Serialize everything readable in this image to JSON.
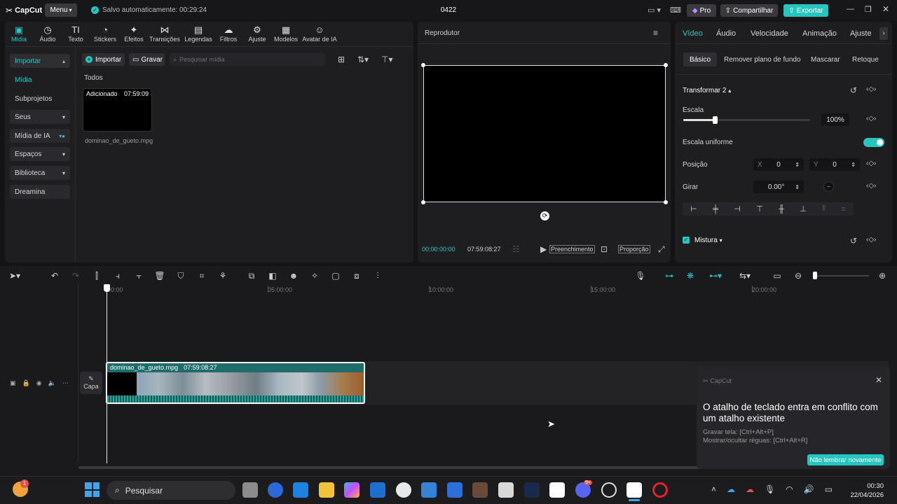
{
  "app": {
    "logo": "CapCut",
    "menu": "Menu",
    "saved": "Salvo automaticamente: 00:29:24",
    "project": "0422",
    "pro": "Pro",
    "share": "Compartilhar",
    "export": "Exportar"
  },
  "media_tabs": [
    "Mídia",
    "Áudio",
    "Texto",
    "Stickers",
    "Efeitos",
    "Transições",
    "Legendas",
    "Filtros",
    "Ajuste",
    "Modelos",
    "Avatar de IA"
  ],
  "sidebar": {
    "items": [
      "Importar",
      "Mídia",
      "Subprojetos",
      "Seus",
      "Mídia de IA",
      "Espaços",
      "Biblioteca",
      "Dreamina"
    ]
  },
  "media": {
    "import": "Importar",
    "record": "Gravar",
    "search_placeholder": "Pesquisar mídia",
    "section": "Todos",
    "clip_badge": "Adicionado",
    "clip_duration": "07:59:09",
    "clip_name": "dominao_de_gueto.mpg"
  },
  "player": {
    "title": "Reprodutor",
    "time_current": "00:00:00:00",
    "time_total": "07:59:08:27",
    "fill": "Preenchimento",
    "ratio": "Proporção"
  },
  "inspector": {
    "tabs": [
      "Vídeo",
      "Áudio",
      "Velocidade",
      "Animação",
      "Ajuste"
    ],
    "subtabs": [
      "Básico",
      "Remover plano de fundo",
      "Mascarar",
      "Retoque"
    ],
    "transform": "Transformar 2",
    "scale_label": "Escala",
    "scale_value": "100%",
    "scale_fraction": 0.25,
    "uniform": "Escala uniforme",
    "position": "Posição",
    "pos_x_label": "X",
    "pos_x": "0",
    "pos_y_label": "Y",
    "pos_y": "0",
    "rotate": "Girar",
    "rotate_value": "0.00°",
    "blend": "Mistura"
  },
  "timeline": {
    "ruler": [
      "00:00",
      "05:00:00",
      "10:00:00",
      "15:00:00",
      "20:00:00"
    ],
    "cover": "Capa",
    "clip_name": "dominao_de_gueto.mpg",
    "clip_duration": "07:59:08:27"
  },
  "toast": {
    "brand": "CapCut",
    "title": "O atalho de teclado entra em conflito com um atalho existente",
    "line1": "Gravar tela: [Ctrl+Alt+P]",
    "line2": "Mostrar/ocultar réguas: [Ctrl+Alt+R]",
    "button": "Não lembrar novamente"
  },
  "taskbar": {
    "search": "Pesquisar",
    "time": "00:30",
    "date": "22/04/2026",
    "badge": "1",
    "badge2": "9+"
  },
  "colors": {
    "accent": "#26c6c0",
    "bg": "#141416",
    "panel": "#1e1e21"
  }
}
